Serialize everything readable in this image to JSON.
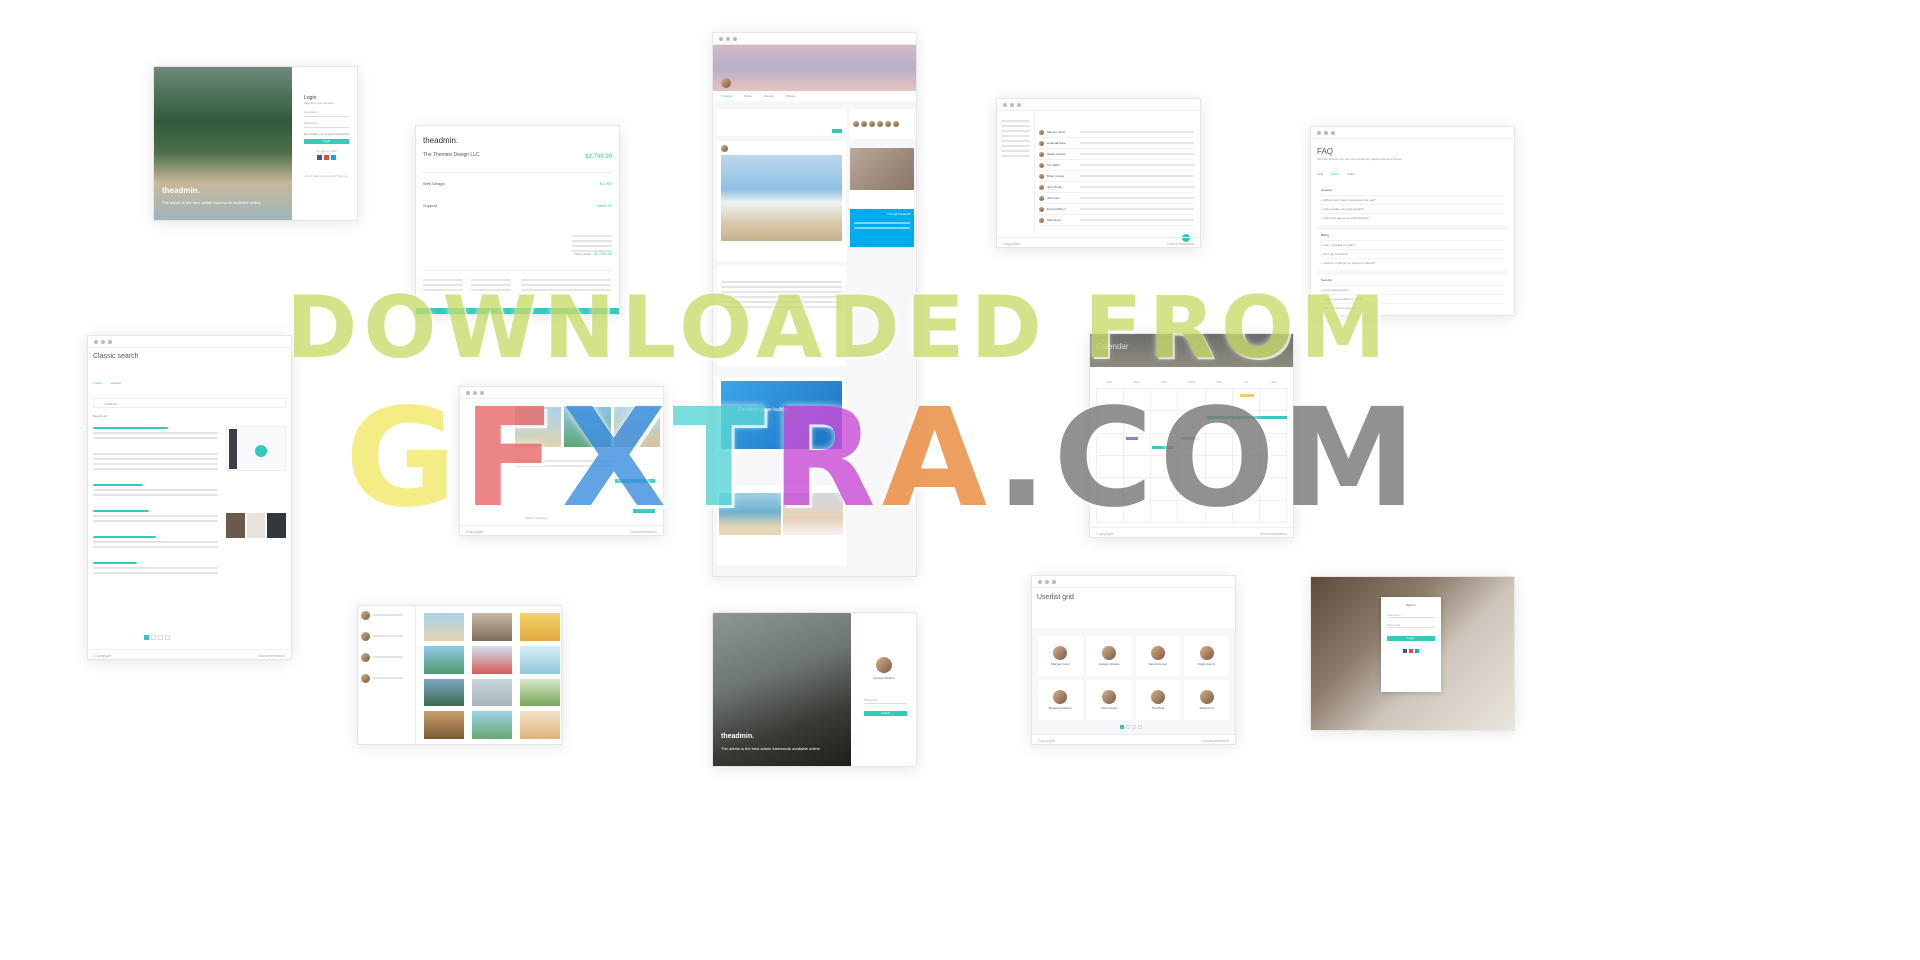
{
  "login_card": {
    "brand": "theadmin.",
    "tagline": "The admin is the best admin framework available online.",
    "title": "Login",
    "subtitle": "Sign into your account",
    "username": "Username",
    "password": "Password",
    "remember": "Remember me",
    "forgot": "Forgot password?",
    "login_button": "Login",
    "or": "Or Sign In With",
    "register": "Don't have an account? Sign up"
  },
  "invoice": {
    "brand": "theadmin.",
    "company": "The Themeix Design LLC",
    "amount_total": "$2,799.99",
    "web_design": "Web Design",
    "support": "Support",
    "web_price": "$1,950",
    "support_price": "$849.99",
    "totals_label": "TOTAL DUE",
    "totals_value": "$2,799.99"
  },
  "profile": {
    "tabs": [
      "Timeline",
      "Posts",
      "Friends",
      "Photos"
    ],
    "tweet_label": "Post @TheAdmin",
    "video_title": "Theadmin page builder"
  },
  "mail": {
    "senders": [
      "Maryam Amiri",
      "Amanda Ashe",
      "Sarah Conner",
      "Tim Hank",
      "Brian Cooley",
      "Jane Smith",
      "John Doe",
      "Emma Wilson",
      "Mike Ross"
    ]
  },
  "faq": {
    "title": "FAQ",
    "subtitle": "Find the answers for the most frequently asked questions below",
    "tabs": [
      "Help",
      "Billing",
      "Sales"
    ],
    "sections": [
      {
        "name": "General",
        "q": [
          "Where can I learn more about the app?",
          "How quickly can I get started?",
          "Does this app come with support?"
        ]
      },
      {
        "name": "Billing",
        "q": [
          "Can I upgrade my plan?",
          "Do I get a refund?",
          "How do I change my payment method?"
        ]
      },
      {
        "name": "Security",
        "q": [
          "Is my data secure?",
          "How do you protect my data?",
          "Can I delete my account?"
        ]
      }
    ]
  },
  "search": {
    "title": "Classic search",
    "tabs": [
      "Classic",
      "Vertical"
    ],
    "placeholder": "Search...",
    "results_label": "Results for"
  },
  "chat": {
    "placeholder": "Write something..."
  },
  "calendar": {
    "title": "Calendar",
    "days": [
      "Sun",
      "Mon",
      "Tue",
      "Wed",
      "Thu",
      "Fri",
      "Sat"
    ]
  },
  "usergrid": {
    "title": "Userlist grid",
    "users": [
      "Maryam Amiri",
      "Hossein Shams",
      "Sarah Conner",
      "Frank Camly",
      "Brooke Anderson",
      "Ivan Connor",
      "The Rock",
      "Sarah Fort"
    ]
  },
  "lockscreen": {
    "brand": "theadmin.",
    "tagline": "The admin is the best admin framework available online.",
    "name": "Hossein Shams",
    "password": "Password",
    "button": "Unlock"
  },
  "login_small": {
    "title": "Sign in",
    "username": "Username",
    "password": "Password",
    "button": "Login"
  },
  "watermark": {
    "line1": "DOWNLOADED FROM",
    "line2": "GFXTRA.COM"
  },
  "colors": {
    "accent": "#33cabb",
    "twitter": "#00aced",
    "wm_line1": "#c9dc6a",
    "wm_g": "#f2e86a",
    "wm_f": "#e86b6b",
    "wm_x": "#3f8fe0",
    "wm_t": "#5cd6d6",
    "wm_r": "#c94fd8",
    "wm_a": "#ea8a3c",
    "wm_com": "#7a7a7a"
  }
}
